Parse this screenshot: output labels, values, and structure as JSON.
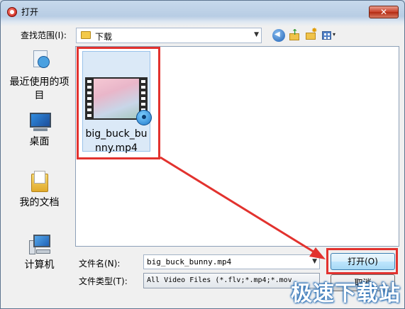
{
  "window": {
    "title": "打开",
    "close_label": "✕"
  },
  "lookin": {
    "label": "查找范围(I):",
    "value": "下载"
  },
  "toolbar": {
    "icons": [
      "back-icon",
      "up-folder-icon",
      "new-folder-icon",
      "view-menu-icon"
    ],
    "view_dropdown": "▾"
  },
  "places": {
    "items": [
      {
        "label": "最近使用的项目",
        "icon": "recent-items-icon"
      },
      {
        "label": "桌面",
        "icon": "desktop-icon"
      },
      {
        "label": "我的文档",
        "icon": "documents-folder-icon"
      },
      {
        "label": "计算机",
        "icon": "computer-icon"
      }
    ]
  },
  "files": [
    {
      "name": "big_buck_bunny.mp4",
      "selected": true,
      "icon": "video-file-icon"
    }
  ],
  "filename": {
    "label": "文件名(N):",
    "value": "big_buck_bunny.mp4"
  },
  "filetype": {
    "label": "文件类型(T):",
    "value": "All Video Files (*.flv;*.mp4;*.mov"
  },
  "buttons": {
    "open": "打开(O)",
    "cancel": "取消"
  },
  "watermark": "极速下载站",
  "colors": {
    "highlight": "#e2322e",
    "selection": "#dbe9f7",
    "accent": "#3c7fb1"
  }
}
